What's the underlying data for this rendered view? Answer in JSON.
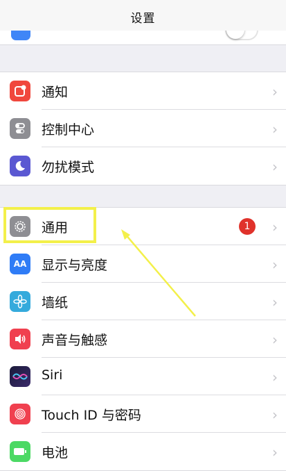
{
  "nav": {
    "title": "设置"
  },
  "group1": [
    {
      "label": "通知",
      "icon": "notification-icon",
      "color": "#f0473d",
      "glyph": "●"
    },
    {
      "label": "控制中心",
      "icon": "control-center-icon",
      "color": "#8e8e93",
      "glyph": "◐"
    },
    {
      "label": "勿扰模式",
      "icon": "moon-icon",
      "color": "#5a58d2",
      "glyph": "☾"
    }
  ],
  "group2": [
    {
      "label": "通用",
      "icon": "gear-icon",
      "color": "#8e8e93",
      "glyph": "⚙",
      "badge": "1"
    },
    {
      "label": "显示与亮度",
      "icon": "display-brightness-icon",
      "color": "#2f7cf6",
      "glyph": "AA"
    },
    {
      "label": "墙纸",
      "icon": "wallpaper-icon",
      "color": "#35aadc",
      "glyph": "✿"
    },
    {
      "label": "声音与触感",
      "icon": "sound-icon",
      "color": "#f0404f",
      "glyph": "◀)"
    },
    {
      "label": "Siri",
      "icon": "siri-icon",
      "color": "#222244",
      "glyph": "◉"
    },
    {
      "label": "Touch ID 与密码",
      "icon": "fingerprint-icon",
      "color": "#f0404f",
      "glyph": "◎"
    },
    {
      "label": "电池",
      "icon": "battery-icon",
      "color": "#4cd964",
      "glyph": "▭"
    }
  ],
  "chevron": "›"
}
